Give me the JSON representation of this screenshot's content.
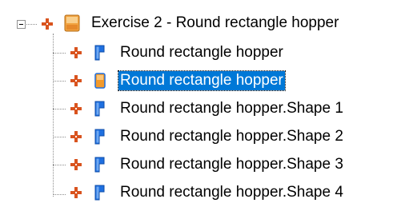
{
  "tree": {
    "root": {
      "label": "Exercise 2 - Round rectangle hopper",
      "expanded": true
    },
    "children": [
      {
        "label": "Round rectangle hopper",
        "icon": "blue-part-icon",
        "selected": false
      },
      {
        "label": "Round rectangle hopper",
        "icon": "orange-part-icon",
        "selected": true
      },
      {
        "label": "Round rectangle hopper.Shape 1",
        "icon": "blue-part-icon",
        "selected": false
      },
      {
        "label": "Round rectangle hopper.Shape 2",
        "icon": "blue-part-icon",
        "selected": false
      },
      {
        "label": "Round rectangle hopper.Shape 3",
        "icon": "blue-part-icon",
        "selected": false
      },
      {
        "label": "Round rectangle hopper.Shape 4",
        "icon": "blue-part-icon",
        "selected": false
      }
    ]
  },
  "colors": {
    "selection": "#0078d7",
    "cross": "#d9531e",
    "part_blue": "#1e6fe0",
    "part_orange": "#f39a2b",
    "connector": "#8c8c8c"
  }
}
